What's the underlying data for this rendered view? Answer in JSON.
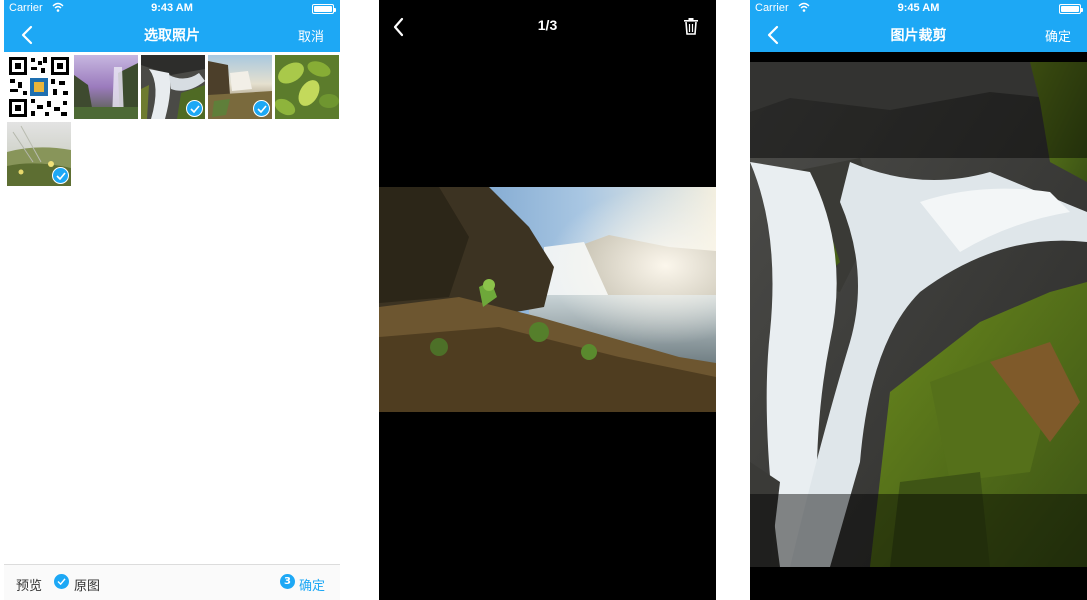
{
  "screen1": {
    "status": {
      "carrier": "Carrier",
      "time": "9:43 AM"
    },
    "nav": {
      "title": "选取照片",
      "cancel": "取消"
    },
    "photos": [
      {
        "name": "qr-code-photo",
        "selected": false
      },
      {
        "name": "purple-waterfall-photo",
        "selected": false
      },
      {
        "name": "cascade-photo",
        "selected": true
      },
      {
        "name": "wide-waterfall-photo",
        "selected": true
      },
      {
        "name": "green-leaves-photo",
        "selected": false
      },
      {
        "name": "wildflower-photo",
        "selected": true
      }
    ],
    "bottom": {
      "preview": "预览",
      "original": "原图",
      "count": "3",
      "confirm": "确定"
    }
  },
  "screen2": {
    "counter": "1/3",
    "icons": {
      "back": "chevron-left-icon",
      "delete": "trash-icon"
    }
  },
  "screen3": {
    "status": {
      "carrier": "Carrier",
      "time": "9:45 AM"
    },
    "nav": {
      "title": "图片裁剪",
      "confirm": "确定"
    }
  },
  "colors": {
    "accent": "#1da8f5",
    "viewer_bg": "#000000"
  }
}
